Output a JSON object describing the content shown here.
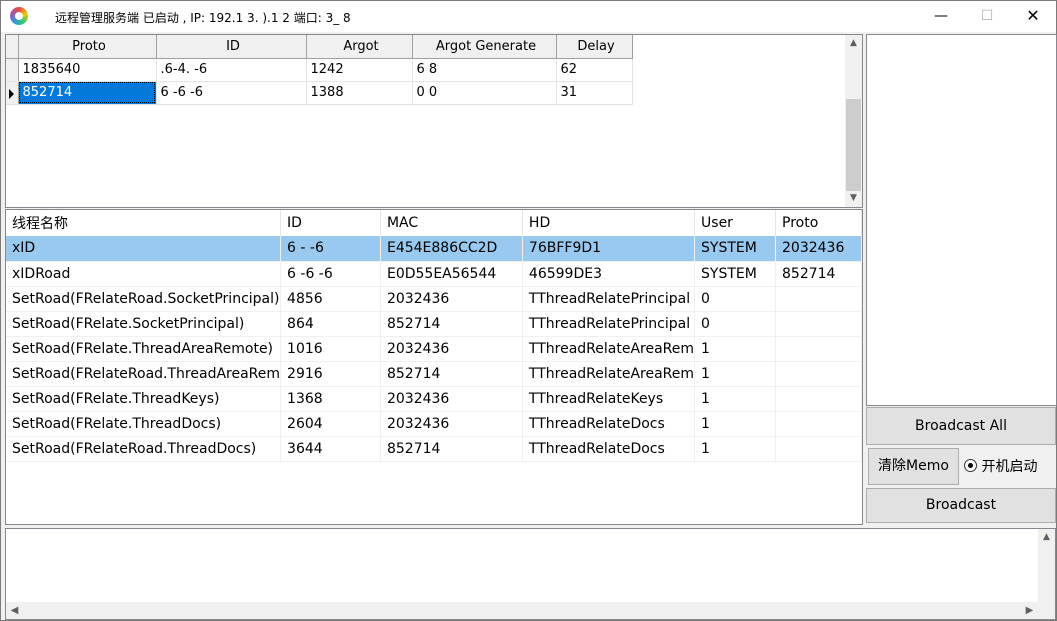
{
  "window": {
    "title": "远程管理服务端 已启动 , IP: 192.1 3. ).1 2 端口: 3_ 8",
    "icons": {
      "app": "app-logo-icon",
      "minimize": "minimize-icon",
      "maximize": "maximize-icon",
      "close": "close-icon"
    }
  },
  "top_grid": {
    "columns": [
      "Proto",
      "ID",
      "Argot",
      "Argot Generate",
      "Delay"
    ],
    "rows": [
      [
        "1835640",
        ".6-4. -6",
        "1242",
        "6 8",
        "62"
      ],
      [
        "852714",
        "6 -6 -6",
        "1388",
        "0 0",
        "31"
      ]
    ],
    "selected_row": 1
  },
  "thread_list": {
    "columns": [
      "线程名称",
      "ID",
      "MAC",
      "HD",
      "User",
      "Proto"
    ],
    "rows": [
      [
        "xID",
        "6 - -6",
        "E454E886CC2D",
        "76BFF9D1",
        "SYSTEM",
        "2032436"
      ],
      [
        "xIDRoad",
        "6 -6 -6",
        "E0D55EA56544",
        "46599DE3",
        "SYSTEM",
        "852714"
      ],
      [
        "SetRoad(FRelateRoad.SocketPrincipal)",
        "4856",
        "2032436",
        "TThreadRelatePrincipal",
        "0",
        ""
      ],
      [
        "SetRoad(FRelate.SocketPrincipal)",
        "864",
        "852714",
        "TThreadRelatePrincipal",
        "0",
        ""
      ],
      [
        "SetRoad(FRelate.ThreadAreaRemote)",
        "1016",
        "2032436",
        "TThreadRelateAreaRem",
        "1",
        ""
      ],
      [
        "SetRoad(FRelateRoad.ThreadAreaRem",
        "2916",
        "852714",
        "TThreadRelateAreaRem",
        "1",
        ""
      ],
      [
        "SetRoad(FRelate.ThreadKeys)",
        "1368",
        "2032436",
        "TThreadRelateKeys",
        "1",
        ""
      ],
      [
        "SetRoad(FRelate.ThreadDocs)",
        "2604",
        "2032436",
        "TThreadRelateDocs",
        "1",
        ""
      ],
      [
        "SetRoad(FRelateRoad.ThreadDocs)",
        "3644",
        "852714",
        "TThreadRelateDocs",
        "1",
        ""
      ]
    ],
    "selected_row": 0
  },
  "controls": {
    "broadcast_all_label": "Broadcast All",
    "clear_memo_label": "清除Memo",
    "autostart_label": "开机启动",
    "autostart_checked": true,
    "broadcast_label": "Broadcast"
  },
  "memo": {
    "text": ""
  }
}
